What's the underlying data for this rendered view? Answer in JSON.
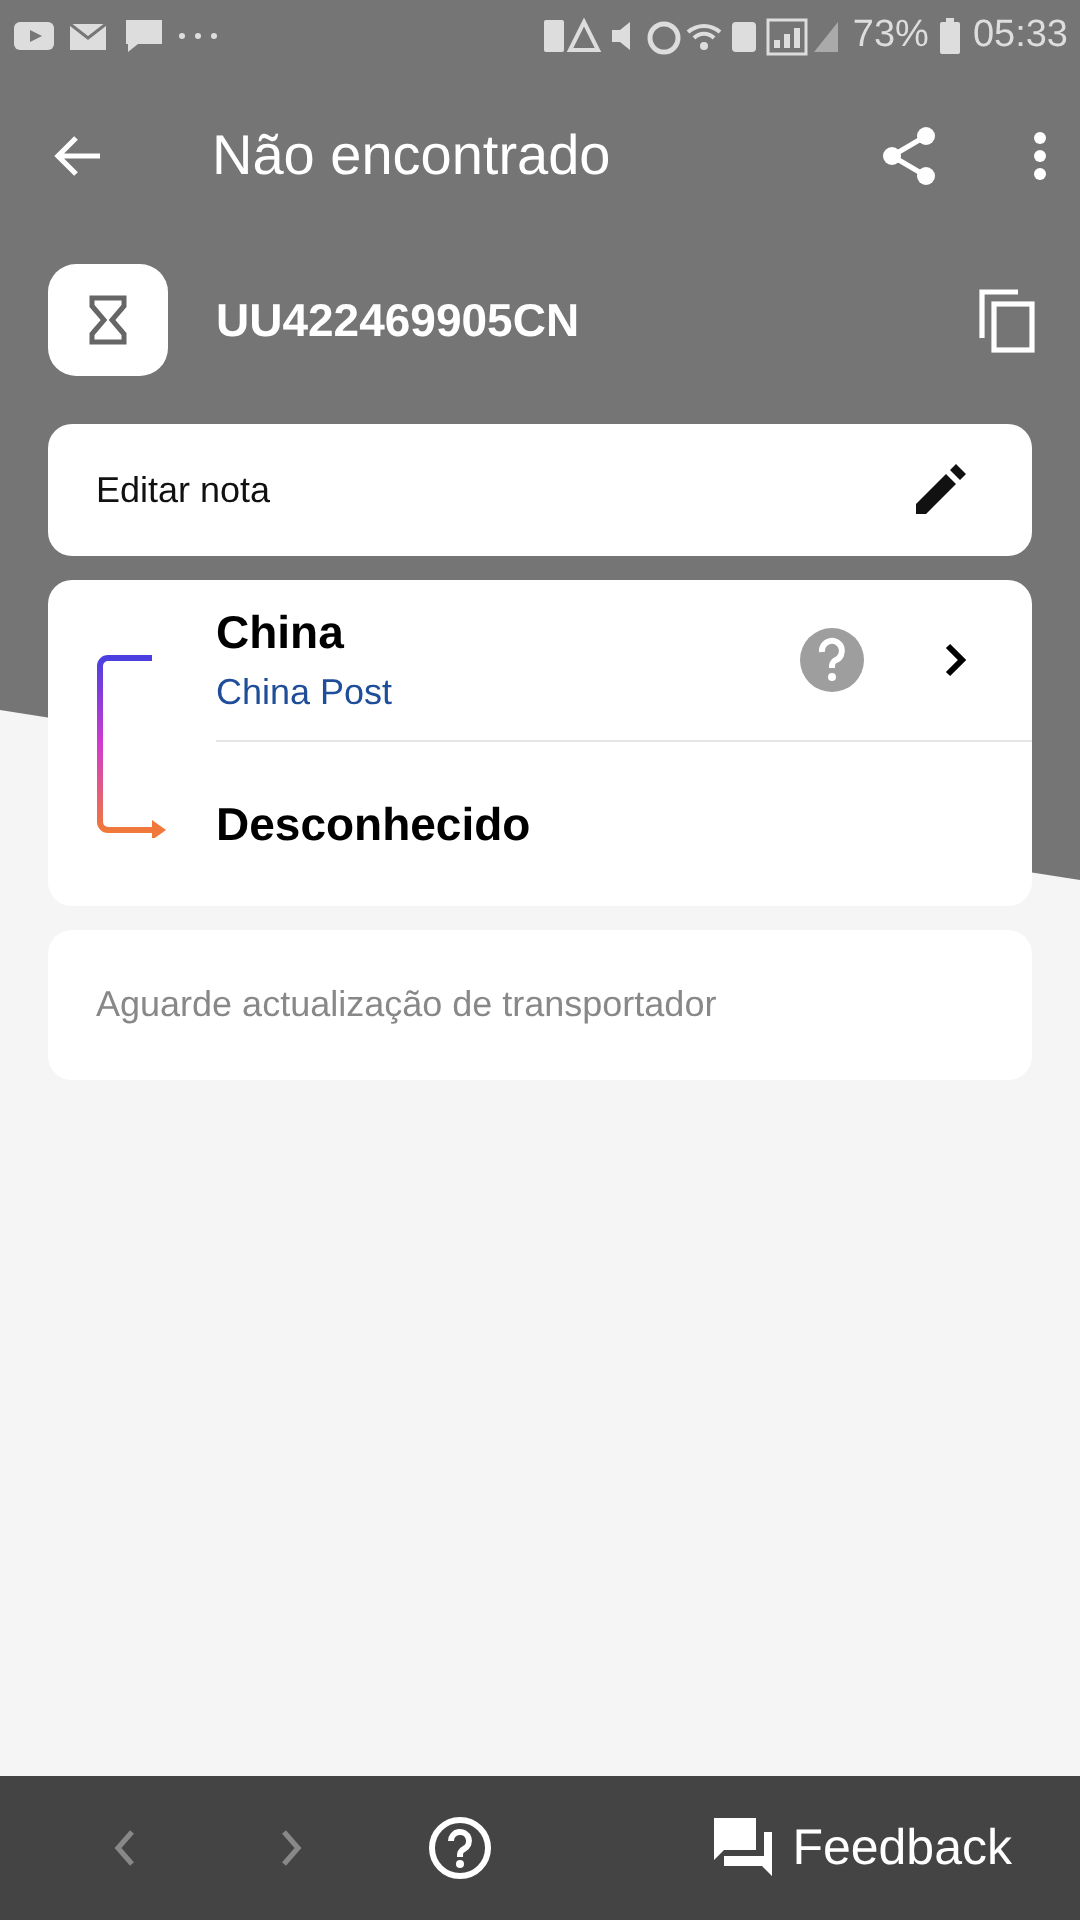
{
  "status_bar": {
    "battery": "73%",
    "time": "05:33"
  },
  "app_bar": {
    "title": "Não encontrado"
  },
  "tracking": {
    "number": "UU422469905CN"
  },
  "note": {
    "label": "Editar nota"
  },
  "route": {
    "origin": "China",
    "carrier": "China Post",
    "destination": "Desconhecido"
  },
  "message": {
    "text": "Aguarde actualização de transportador"
  },
  "bottom_bar": {
    "back_disabled": true,
    "forward_disabled": true,
    "feedback": "Feedback"
  }
}
